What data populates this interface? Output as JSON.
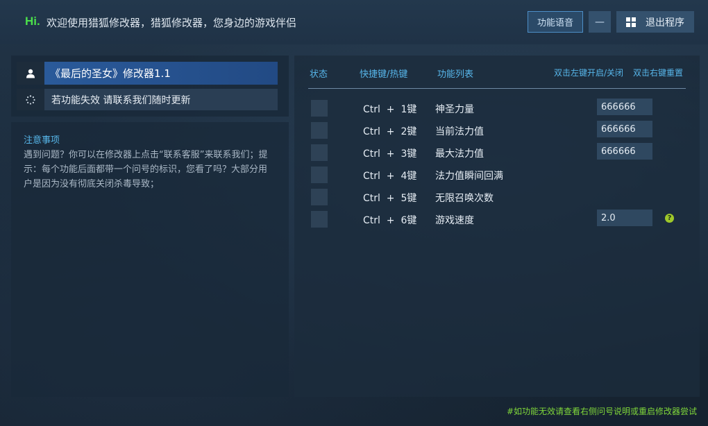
{
  "header": {
    "hi": "Hi.",
    "welcome": "欢迎使用猎狐修改器，猎狐修改器，您身边的游戏伴侣",
    "voice_button": "功能语音",
    "minimize_button": "—",
    "exit_button": "退出程序"
  },
  "left": {
    "title": "《最后的圣女》修改器1.1",
    "notice": "若功能失效 请联系我们随时更新",
    "notes_title": "注意事项",
    "notes_body": "遇到问题？你可以在修改器上点击“联系客服”来联系我们；提示：每个功能后面都带一个问号的标识，您看了吗？大部分用户是因为没有彻底关闭杀毒导致；"
  },
  "table": {
    "headers": {
      "status": "状态",
      "hotkey": "快捷键/热键",
      "functions": "功能列表",
      "toggle_hint": "双击左键开启/关闭",
      "reset_hint": "双击右键重置"
    },
    "rows": [
      {
        "hotkey": "Ctrl  +  1键",
        "name": "神圣力量",
        "value": "666666"
      },
      {
        "hotkey": "Ctrl  +  2键",
        "name": "当前法力值",
        "value": "666666"
      },
      {
        "hotkey": "Ctrl  +  3键",
        "name": "最大法力值",
        "value": "666666"
      },
      {
        "hotkey": "Ctrl  +  4键",
        "name": "法力值瞬间回满"
      },
      {
        "hotkey": "Ctrl  +  5键",
        "name": "无限召唤次数"
      },
      {
        "hotkey": "Ctrl  +  6键",
        "name": "游戏速度",
        "value": "2.0",
        "help": "?"
      }
    ]
  },
  "footer": {
    "note": "#如功能无效请查看右侧问号说明或重启修改器尝试"
  },
  "colors": {
    "accent_blue": "#57b6ea",
    "hi_green": "#4be04b",
    "footer_green": "#7fd63a",
    "title_bar": "#2a5a9a"
  }
}
